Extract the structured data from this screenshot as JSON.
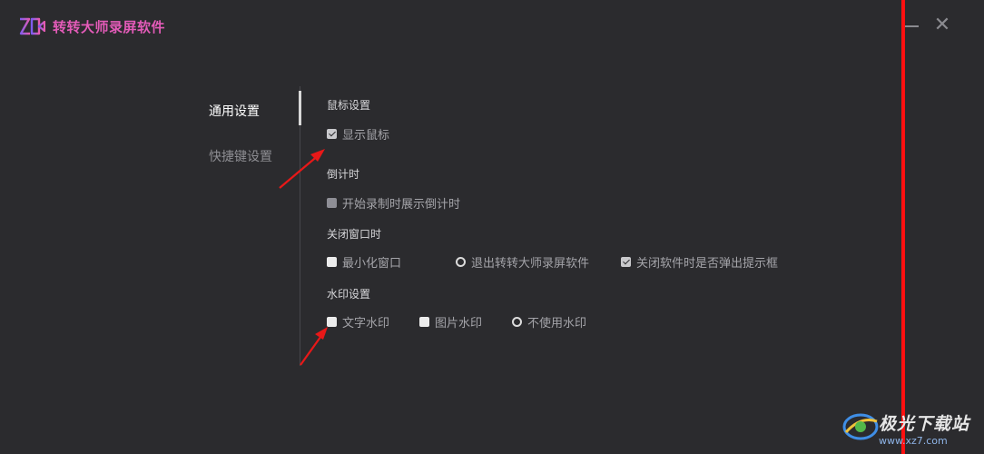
{
  "app": {
    "title": "转转大师录屏软件",
    "brand_color": "#e35bb8"
  },
  "window_controls": {
    "minimize_icon": "minimize-icon",
    "close_symbol": "✕"
  },
  "nav": {
    "items": [
      {
        "label": "通用设置",
        "active": true
      },
      {
        "label": "快捷键设置",
        "active": false
      }
    ]
  },
  "mouse": {
    "title": "鼠标设置",
    "show_cursor": {
      "label": "显示鼠标",
      "checked": true
    }
  },
  "countdown": {
    "title": "倒计时",
    "show_countdown": {
      "label": "开始录制时展示倒计时",
      "checked": false
    }
  },
  "close_window": {
    "title": "关闭窗口时",
    "options": [
      {
        "label": "最小化窗口",
        "selected": false
      },
      {
        "label": "退出转转大师录屏软件",
        "selected": true
      },
      {
        "label": "关闭软件时是否弹出提示框",
        "checked": true
      }
    ]
  },
  "watermark": {
    "title": "水印设置",
    "options": [
      {
        "label": "文字水印",
        "selected": false
      },
      {
        "label": "图片水印",
        "selected": false
      },
      {
        "label": "不使用水印",
        "selected": true
      }
    ]
  },
  "overlay": {
    "watermark_text": "极光下载站",
    "watermark_url": "www.xz7.com",
    "annotation_color": "#e81818",
    "divider_color": "#ff1010"
  }
}
